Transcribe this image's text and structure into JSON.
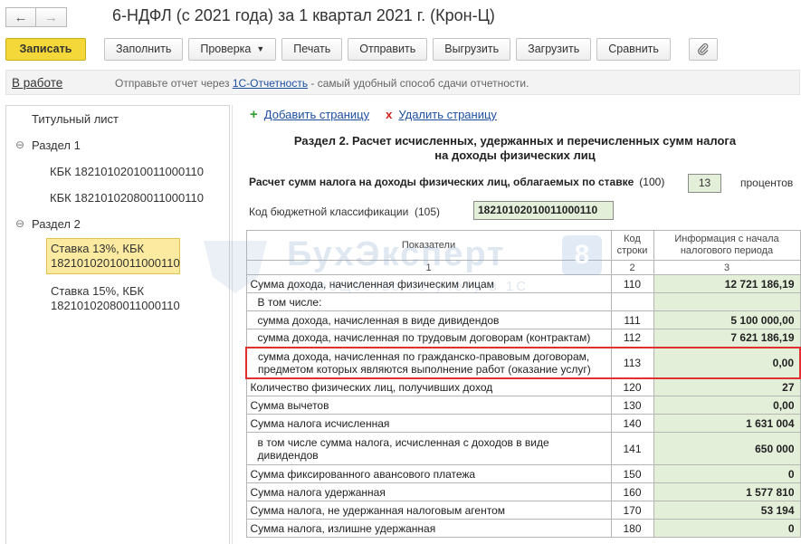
{
  "window": {
    "title": "6-НДФЛ (с 2021 года) за 1 квартал 2021 г. (Крон-Ц)"
  },
  "nav": {
    "back_icon": "arrow-left-icon",
    "forward_icon": "arrow-right-icon"
  },
  "toolbar": {
    "save": "Записать",
    "fill": "Заполнить",
    "check": "Проверка",
    "print": "Печать",
    "send": "Отправить",
    "export": "Выгрузить",
    "load": "Загрузить",
    "compare": "Сравнить",
    "attach_icon": "paperclip-icon"
  },
  "infobar": {
    "status": "В работе",
    "hint_before": "Отправьте отчет через ",
    "hint_link": "1С-Отчетность",
    "hint_after": " - самый удобный способ сдачи отчетности."
  },
  "tree": {
    "title_sheet": "Титульный лист",
    "section1": "Раздел 1",
    "s1_kbk1": "КБК 18210102010011000110",
    "s1_kbk2": "КБК 18210102080011000110",
    "section2": "Раздел 2",
    "s2_item1_line1": "Ставка 13%, КБК",
    "s2_item1_line2": "18210102010011000110",
    "s2_item2_line1": "Ставка 15%, КБК",
    "s2_item2_line2": "18210102080011000110"
  },
  "actions": {
    "add_page": "Добавить страницу",
    "delete_page": "Удалить страницу"
  },
  "section": {
    "title_line1": "Раздел 2. Расчет исчисленных, удержанных и перечисленных сумм налога",
    "title_line2": "на доходы физических лиц",
    "rate_label": "Расчет сумм налога на доходы физических лиц, облагаемых по ставке",
    "rate_code": "(100)",
    "rate_value": "13",
    "rate_unit": "процентов",
    "kbk_label": "Код бюджетной классификации",
    "kbk_code": "(105)",
    "kbk_value": "18210102010011000110"
  },
  "table": {
    "headers": {
      "indicators": "Показатели",
      "line_code": "Код строки",
      "info": "Информация с начала налогового периода"
    },
    "col_numbers": [
      "1",
      "2",
      "3"
    ],
    "rows": [
      {
        "name": "Сумма дохода, начисленная физическим лицам",
        "code": "110",
        "value": "12 721 186,19"
      },
      {
        "name": "В том числе:",
        "code": "",
        "value": ""
      },
      {
        "name": "сумма дохода, начисленная в виде дивидендов",
        "code": "111",
        "value": "5 100 000,00"
      },
      {
        "name": "сумма дохода, начисленная по трудовым договорам (контрактам)",
        "code": "112",
        "value": "7 621 186,19"
      },
      {
        "name": "сумма дохода, начисленная по гражданско-правовым договорам, предметом которых являются выполнение работ (оказание услуг)",
        "code": "113",
        "value": "0,00"
      },
      {
        "name": "Количество физических лиц, получивших доход",
        "code": "120",
        "value": "27"
      },
      {
        "name": "Сумма вычетов",
        "code": "130",
        "value": "0,00"
      },
      {
        "name": "Сумма налога исчисленная",
        "code": "140",
        "value": "1 631 004"
      },
      {
        "name": "в том числе сумма налога, исчисленная с доходов в виде дивидендов",
        "code": "141",
        "value": "650 000"
      },
      {
        "name": "Сумма фиксированного авансового платежа",
        "code": "150",
        "value": "0"
      },
      {
        "name": "Сумма налога удержанная",
        "code": "160",
        "value": "1 577 810"
      },
      {
        "name": "Сумма налога, не удержанная налоговым агентом",
        "code": "170",
        "value": "53 194"
      },
      {
        "name": "Сумма налога, излишне удержанная",
        "code": "180",
        "value": "0"
      }
    ]
  },
  "watermark": {
    "brand": "БухЭксперт",
    "badge": "8",
    "tagline": "Сообщество по учету в 1С"
  }
}
